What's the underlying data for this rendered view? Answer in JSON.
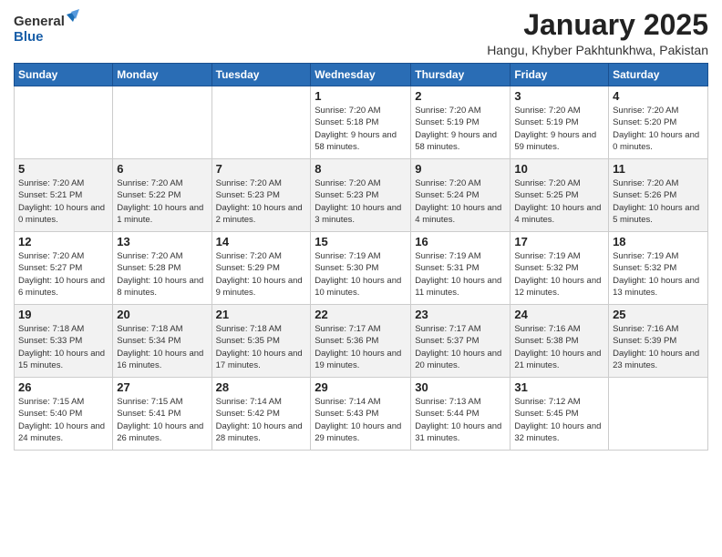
{
  "header": {
    "logo_line1": "General",
    "logo_line2": "Blue",
    "month": "January 2025",
    "location": "Hangu, Khyber Pakhtunkhwa, Pakistan"
  },
  "days_of_week": [
    "Sunday",
    "Monday",
    "Tuesday",
    "Wednesday",
    "Thursday",
    "Friday",
    "Saturday"
  ],
  "weeks": [
    [
      {
        "day": "",
        "info": ""
      },
      {
        "day": "",
        "info": ""
      },
      {
        "day": "",
        "info": ""
      },
      {
        "day": "1",
        "info": "Sunrise: 7:20 AM\nSunset: 5:18 PM\nDaylight: 9 hours\nand 58 minutes."
      },
      {
        "day": "2",
        "info": "Sunrise: 7:20 AM\nSunset: 5:19 PM\nDaylight: 9 hours\nand 58 minutes."
      },
      {
        "day": "3",
        "info": "Sunrise: 7:20 AM\nSunset: 5:19 PM\nDaylight: 9 hours\nand 59 minutes."
      },
      {
        "day": "4",
        "info": "Sunrise: 7:20 AM\nSunset: 5:20 PM\nDaylight: 10 hours\nand 0 minutes."
      }
    ],
    [
      {
        "day": "5",
        "info": "Sunrise: 7:20 AM\nSunset: 5:21 PM\nDaylight: 10 hours\nand 0 minutes."
      },
      {
        "day": "6",
        "info": "Sunrise: 7:20 AM\nSunset: 5:22 PM\nDaylight: 10 hours\nand 1 minute."
      },
      {
        "day": "7",
        "info": "Sunrise: 7:20 AM\nSunset: 5:23 PM\nDaylight: 10 hours\nand 2 minutes."
      },
      {
        "day": "8",
        "info": "Sunrise: 7:20 AM\nSunset: 5:23 PM\nDaylight: 10 hours\nand 3 minutes."
      },
      {
        "day": "9",
        "info": "Sunrise: 7:20 AM\nSunset: 5:24 PM\nDaylight: 10 hours\nand 4 minutes."
      },
      {
        "day": "10",
        "info": "Sunrise: 7:20 AM\nSunset: 5:25 PM\nDaylight: 10 hours\nand 4 minutes."
      },
      {
        "day": "11",
        "info": "Sunrise: 7:20 AM\nSunset: 5:26 PM\nDaylight: 10 hours\nand 5 minutes."
      }
    ],
    [
      {
        "day": "12",
        "info": "Sunrise: 7:20 AM\nSunset: 5:27 PM\nDaylight: 10 hours\nand 6 minutes."
      },
      {
        "day": "13",
        "info": "Sunrise: 7:20 AM\nSunset: 5:28 PM\nDaylight: 10 hours\nand 8 minutes."
      },
      {
        "day": "14",
        "info": "Sunrise: 7:20 AM\nSunset: 5:29 PM\nDaylight: 10 hours\nand 9 minutes."
      },
      {
        "day": "15",
        "info": "Sunrise: 7:19 AM\nSunset: 5:30 PM\nDaylight: 10 hours\nand 10 minutes."
      },
      {
        "day": "16",
        "info": "Sunrise: 7:19 AM\nSunset: 5:31 PM\nDaylight: 10 hours\nand 11 minutes."
      },
      {
        "day": "17",
        "info": "Sunrise: 7:19 AM\nSunset: 5:32 PM\nDaylight: 10 hours\nand 12 minutes."
      },
      {
        "day": "18",
        "info": "Sunrise: 7:19 AM\nSunset: 5:32 PM\nDaylight: 10 hours\nand 13 minutes."
      }
    ],
    [
      {
        "day": "19",
        "info": "Sunrise: 7:18 AM\nSunset: 5:33 PM\nDaylight: 10 hours\nand 15 minutes."
      },
      {
        "day": "20",
        "info": "Sunrise: 7:18 AM\nSunset: 5:34 PM\nDaylight: 10 hours\nand 16 minutes."
      },
      {
        "day": "21",
        "info": "Sunrise: 7:18 AM\nSunset: 5:35 PM\nDaylight: 10 hours\nand 17 minutes."
      },
      {
        "day": "22",
        "info": "Sunrise: 7:17 AM\nSunset: 5:36 PM\nDaylight: 10 hours\nand 19 minutes."
      },
      {
        "day": "23",
        "info": "Sunrise: 7:17 AM\nSunset: 5:37 PM\nDaylight: 10 hours\nand 20 minutes."
      },
      {
        "day": "24",
        "info": "Sunrise: 7:16 AM\nSunset: 5:38 PM\nDaylight: 10 hours\nand 21 minutes."
      },
      {
        "day": "25",
        "info": "Sunrise: 7:16 AM\nSunset: 5:39 PM\nDaylight: 10 hours\nand 23 minutes."
      }
    ],
    [
      {
        "day": "26",
        "info": "Sunrise: 7:15 AM\nSunset: 5:40 PM\nDaylight: 10 hours\nand 24 minutes."
      },
      {
        "day": "27",
        "info": "Sunrise: 7:15 AM\nSunset: 5:41 PM\nDaylight: 10 hours\nand 26 minutes."
      },
      {
        "day": "28",
        "info": "Sunrise: 7:14 AM\nSunset: 5:42 PM\nDaylight: 10 hours\nand 28 minutes."
      },
      {
        "day": "29",
        "info": "Sunrise: 7:14 AM\nSunset: 5:43 PM\nDaylight: 10 hours\nand 29 minutes."
      },
      {
        "day": "30",
        "info": "Sunrise: 7:13 AM\nSunset: 5:44 PM\nDaylight: 10 hours\nand 31 minutes."
      },
      {
        "day": "31",
        "info": "Sunrise: 7:12 AM\nSunset: 5:45 PM\nDaylight: 10 hours\nand 32 minutes."
      },
      {
        "day": "",
        "info": ""
      }
    ]
  ]
}
